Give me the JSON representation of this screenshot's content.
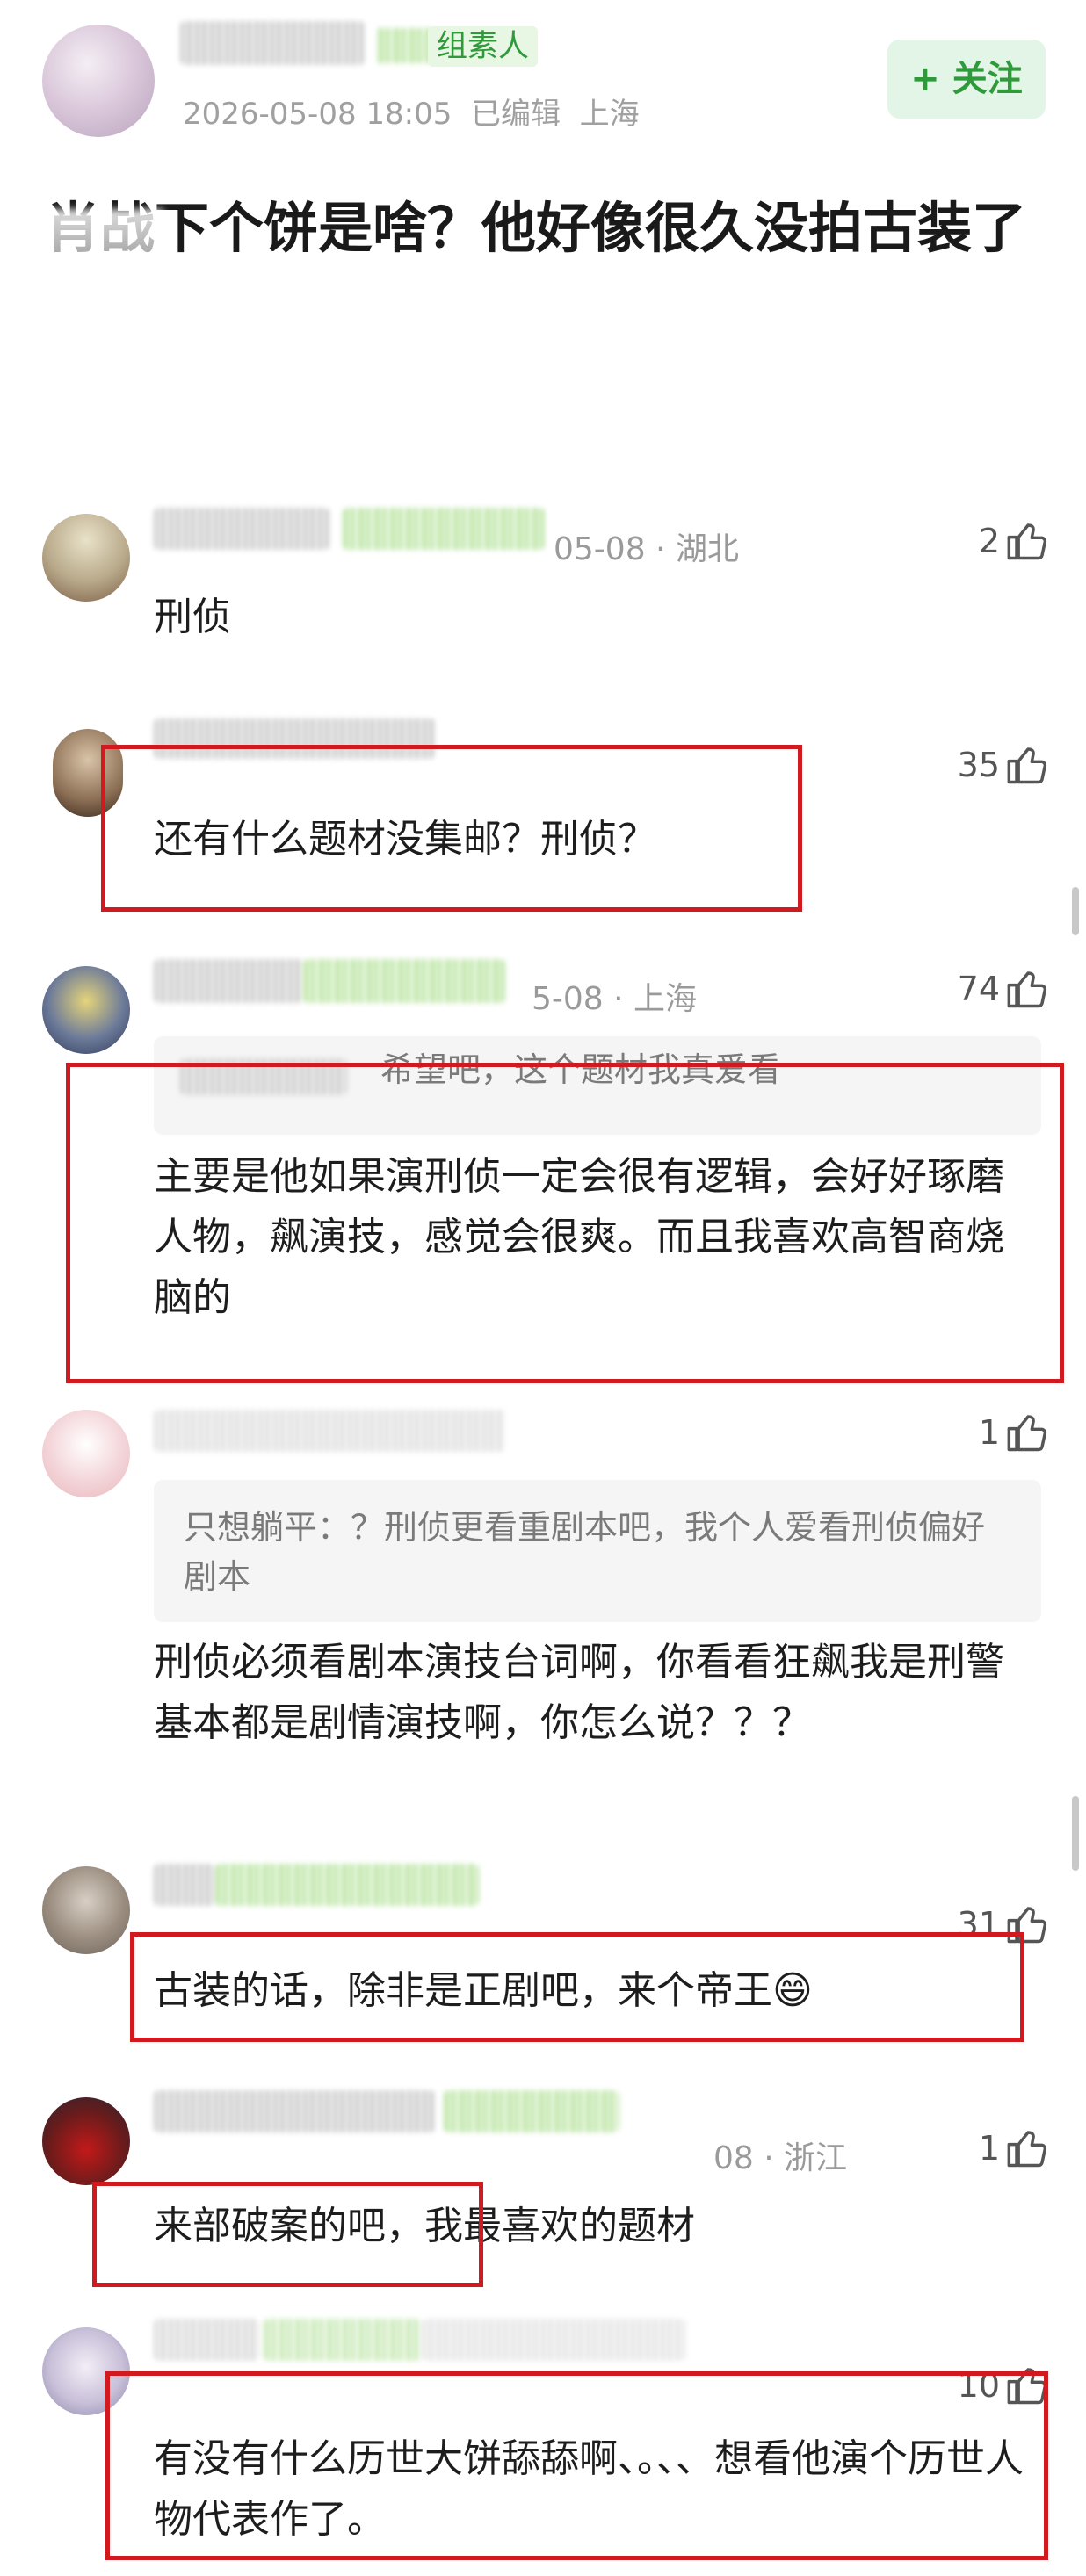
{
  "post": {
    "author_name": "",
    "badge": "组素人",
    "meta": "2026-05-08 18:05  已编辑  上海",
    "follow_label": "+ 关注",
    "title": "肖战下个饼是啥？他好像很久没拍古装了"
  },
  "comments": [
    {
      "meta": "05-08 · 湖北",
      "likes": "2",
      "text": "刑侦"
    },
    {
      "meta": "",
      "likes": "35",
      "text": "还有什么题材没集邮？刑侦？"
    },
    {
      "meta": "5-08 · 上海",
      "likes": "74",
      "quote": "希望吧，这个题材我真爱看",
      "text": "主要是他如果演刑侦一定会很有逻辑，会好好琢磨人物，飙演技，感觉会很爽。而且我喜欢高智商烧脑的"
    },
    {
      "meta": "",
      "likes": "1",
      "quote": "只想躺平：？刑侦更看重剧本吧，我个人爱看刑侦偏好剧本",
      "text": "刑侦必须看剧本演技台词啊，你看看狂飙我是刑警基本都是剧情演技啊，你怎么说？？？"
    },
    {
      "meta": "",
      "likes": "31",
      "text": "古装的话，除非是正剧吧，来个帝王",
      "emoji": "😄"
    },
    {
      "meta": "08 · 浙江",
      "likes": "1",
      "text": "来部破案的吧，我最喜欢的题材"
    },
    {
      "meta": "",
      "likes": "10",
      "text": "有没有什么历世大饼舔舔啊、。、、想看他演个历世人物代表作了。"
    }
  ],
  "colors": {
    "accent_green": "#2e9a3a",
    "follow_bg": "#e3f5e6",
    "highlight_red": "#d11a20"
  }
}
